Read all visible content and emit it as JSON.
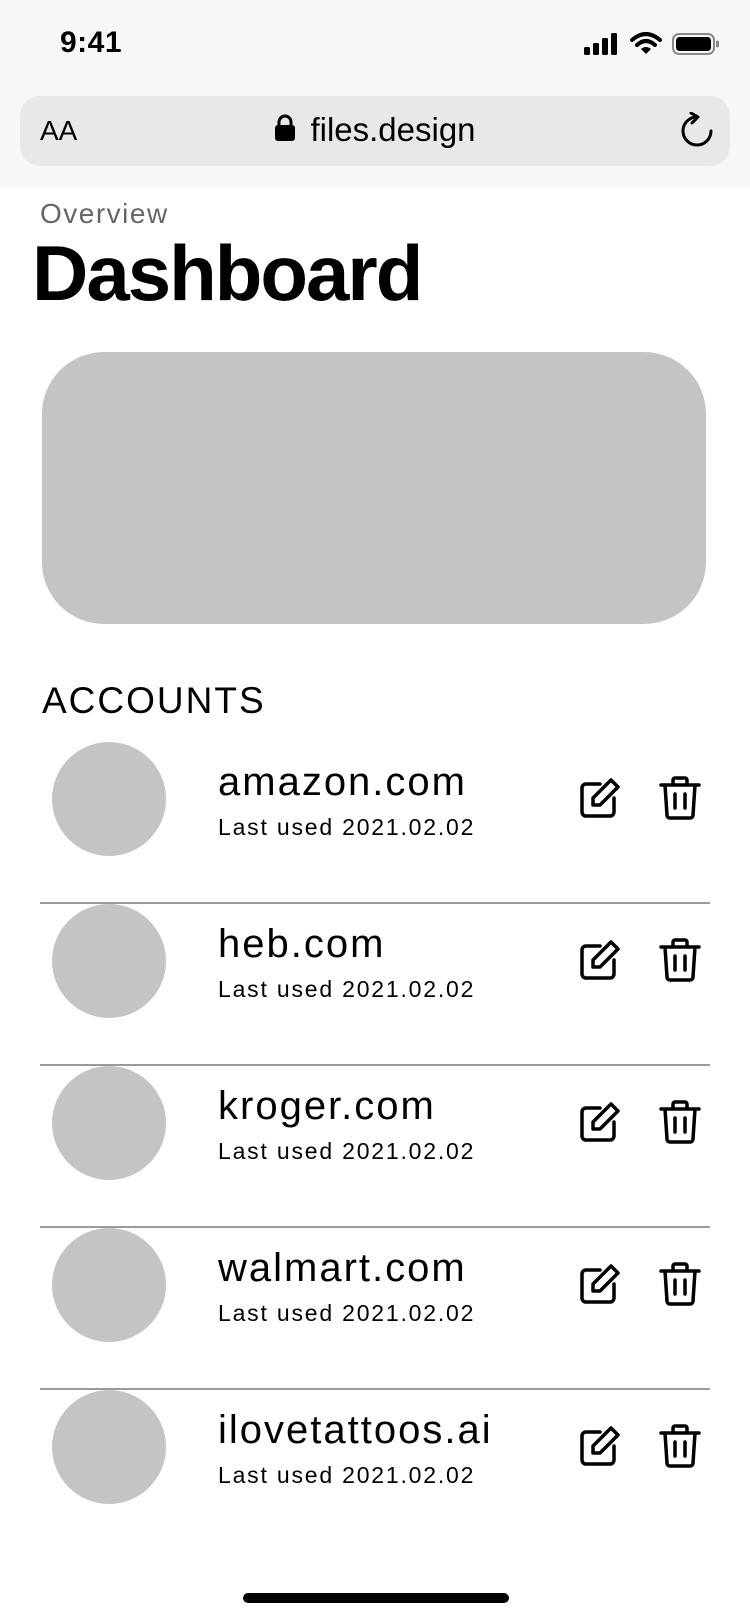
{
  "status_bar": {
    "time": "9:41",
    "icons": [
      "cellular-signal-icon",
      "wifi-icon",
      "battery-icon"
    ]
  },
  "browser": {
    "text_size_label": "AA",
    "url": "files.design",
    "icons": [
      "lock-icon",
      "reload-icon"
    ]
  },
  "page": {
    "overline": "Overview",
    "title": "Dashboard"
  },
  "accounts": {
    "heading": "ACCOUNTS",
    "items": [
      {
        "name": "amazon.com",
        "last_used": "Last used 2021.02.02"
      },
      {
        "name": "heb.com",
        "last_used": "Last used 2021.02.02"
      },
      {
        "name": "kroger.com",
        "last_used": "Last used 2021.02.02"
      },
      {
        "name": "walmart.com",
        "last_used": "Last used 2021.02.02"
      },
      {
        "name": "ilovetattoos.ai",
        "last_used": "Last used 2021.02.02"
      }
    ],
    "row_icons": [
      "edit-icon",
      "trash-icon"
    ]
  },
  "colors": {
    "chrome_background": "#f7f7f7",
    "address_bar": "#e8e8e8",
    "placeholder_gray": "#c4c4c4",
    "divider": "#9a9a9a",
    "text": "#000000",
    "muted_text": "#666666"
  }
}
